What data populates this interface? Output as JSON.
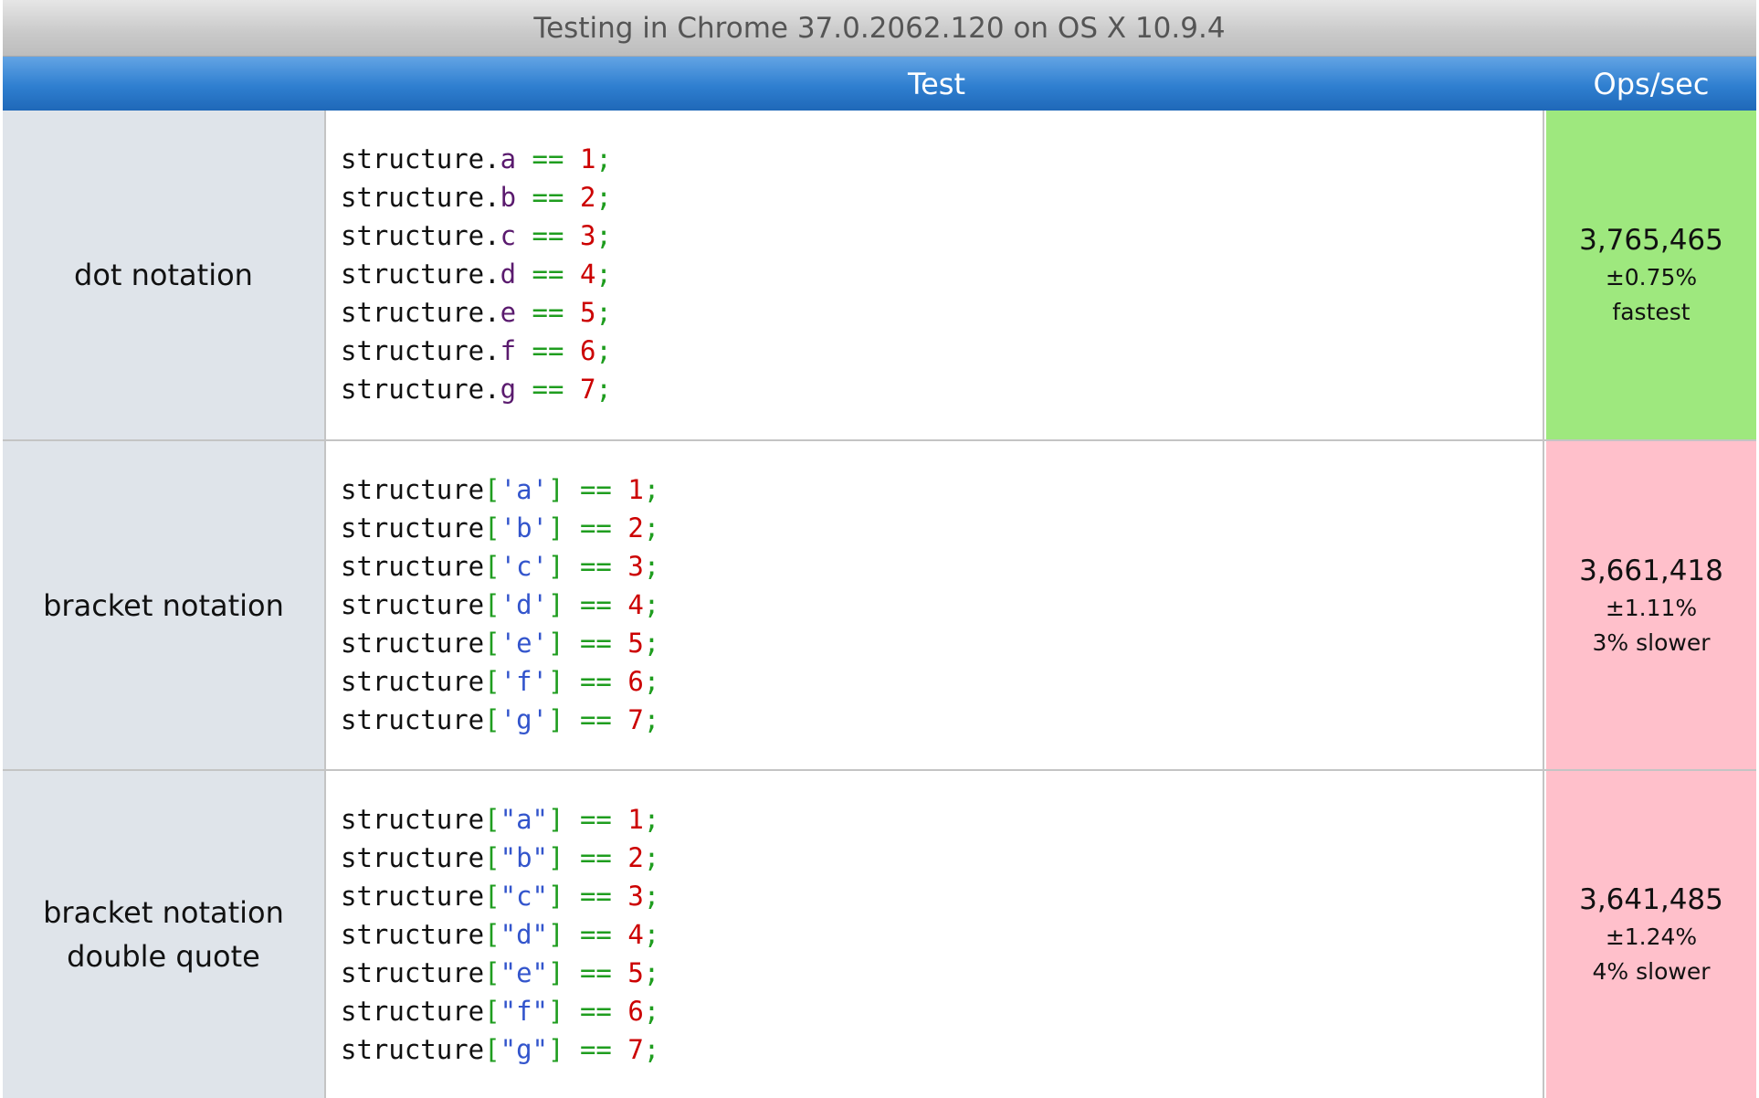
{
  "title": "Testing in Chrome 37.0.2062.120 on OS X 10.9.4",
  "columns": {
    "test": "Test",
    "ops": "Ops/sec"
  },
  "colors": {
    "fastest": "#9ee87e",
    "slower": "#ffc0cb"
  },
  "rows": [
    {
      "name": "dot notation",
      "ops": "3,765,465",
      "error": "±0.75%",
      "relative": "fastest",
      "status": "fastest",
      "code": [
        "structure.a == 1;",
        "structure.b == 2;",
        "structure.c == 3;",
        "structure.d == 4;",
        "structure.e == 5;",
        "structure.f == 6;",
        "structure.g == 7;"
      ]
    },
    {
      "name": "bracket notation",
      "ops": "3,661,418",
      "error": "±1.11%",
      "relative": "3% slower",
      "status": "slower",
      "code": [
        "structure['a'] == 1;",
        "structure['b'] == 2;",
        "structure['c'] == 3;",
        "structure['d'] == 4;",
        "structure['e'] == 5;",
        "structure['f'] == 6;",
        "structure['g'] == 7;"
      ]
    },
    {
      "name": "bracket notation double quote",
      "name_lines": [
        "bracket notation",
        "double quote"
      ],
      "ops": "3,641,485",
      "error": "±1.24%",
      "relative": "4% slower",
      "status": "slower",
      "code": [
        "structure[\"a\"] == 1;",
        "structure[\"b\"] == 2;",
        "structure[\"c\"] == 3;",
        "structure[\"d\"] == 4;",
        "structure[\"e\"] == 5;",
        "structure[\"f\"] == 6;",
        "structure[\"g\"] == 7;"
      ]
    }
  ]
}
